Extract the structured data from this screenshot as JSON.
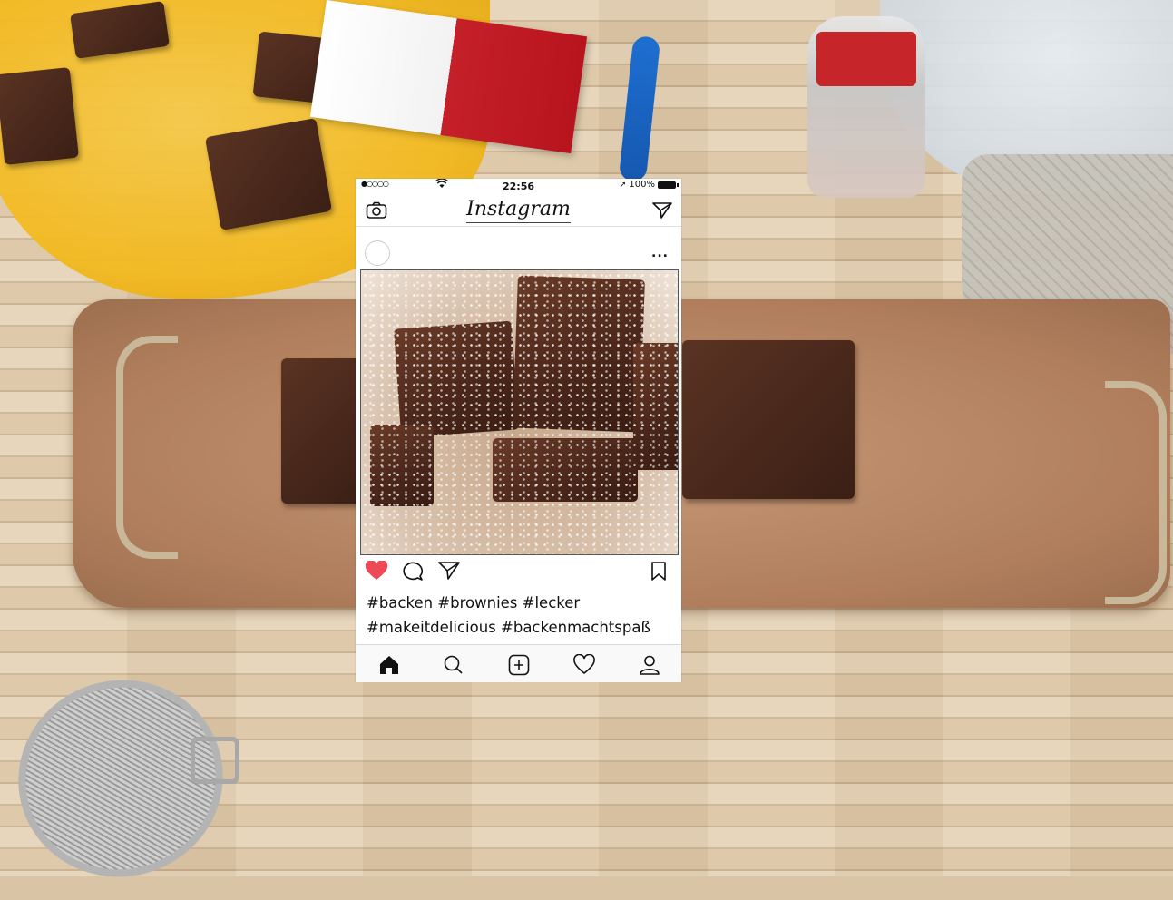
{
  "status_bar": {
    "signal": "●○○○○",
    "time": "22:56",
    "battery": "100%"
  },
  "header": {
    "logo": "Instagram",
    "left_icon": "camera-icon",
    "right_icon": "send-icon"
  },
  "post": {
    "more_label": "...",
    "liked": true,
    "caption_line1": "#backen #brownies #lecker",
    "caption_line2": "#makeitdelicious #backenmachtspaß",
    "action_icons": [
      "heart-icon",
      "comment-icon",
      "share-icon",
      "bookmark-icon"
    ]
  },
  "tabbar": {
    "items": [
      "home-icon",
      "search-icon",
      "add-post-icon",
      "activity-icon",
      "profile-icon"
    ]
  },
  "colors": {
    "like_red": "#ed4956",
    "text": "#111111",
    "divider": "#e2e2e2"
  }
}
